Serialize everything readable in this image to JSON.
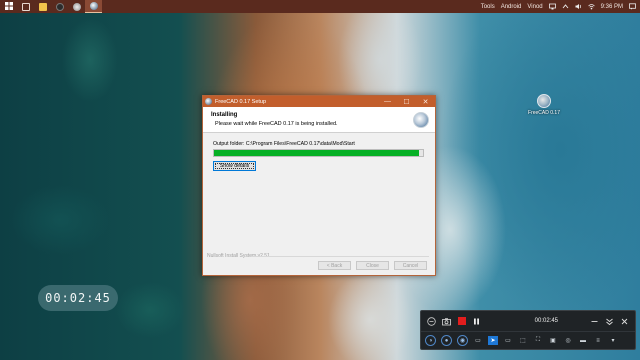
{
  "taskbar": {
    "apps": [
      {
        "name": "windows",
        "icon": "windows-logo-icon"
      },
      {
        "name": "task-view",
        "icon": "task-view-icon"
      },
      {
        "name": "file-explorer",
        "icon": "folder-icon"
      },
      {
        "name": "app-dark",
        "icon": "app-icon"
      },
      {
        "name": "app-circle",
        "icon": "app-icon"
      },
      {
        "name": "freecad-setup",
        "icon": "freecad-icon",
        "active": true
      }
    ],
    "tray": {
      "tools_label": "Tools",
      "android_label": "Android",
      "user_label": "Vinod",
      "time": "9:36 PM"
    }
  },
  "desktop": {
    "icon_label": "FreeCAD 0.17"
  },
  "timer": {
    "value": "00:02:45"
  },
  "installer": {
    "title": "FreeCAD 0.17 Setup",
    "header_title": "Installing",
    "header_subtitle": "Please wait while FreeCAD 0.17 is being installed.",
    "output_folder": "Output folder: C:\\Program Files\\FreeCAD 0.17\\data\\Mod\\Start",
    "progress": 0.98,
    "progress_color": "#06b025",
    "show_details_label": "Show details",
    "brand": "Nullsoft Install System v2.51",
    "back_label": "< Back",
    "close_label": "Close",
    "cancel_label": "Cancel",
    "minimize_glyph": "—",
    "maximize_glyph": "☐",
    "close_glyph": "✕"
  },
  "recorder": {
    "time": "00:02:45",
    "colors": {
      "stop": "#e21d1d",
      "accent": "#1e78d6"
    }
  }
}
